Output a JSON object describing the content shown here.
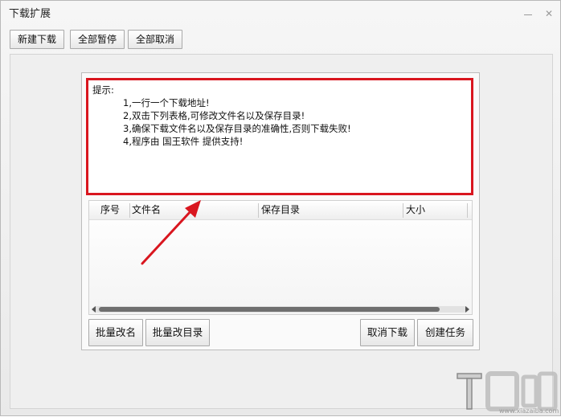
{
  "window": {
    "title": "下载扩展"
  },
  "toolbar": {
    "new_download": "新建下载",
    "pause_all": "全部暂停",
    "cancel_all": "全部取消"
  },
  "hint": {
    "label": "提示:",
    "lines": [
      "1,一行一个下载地址!",
      "2,双击下列表格,可修改文件名以及保存目录!",
      "3,确保下载文件名以及保存目录的准确性,否则下载失败!",
      "4,程序由 国王软件 提供支持!"
    ]
  },
  "table": {
    "columns": [
      "序号",
      "文件名",
      "保存目录",
      "大小"
    ]
  },
  "bottom_buttons": {
    "batch_rename": "批量改名",
    "batch_change_dir": "批量改目录",
    "cancel_download": "取消下载",
    "create_task": "创建任务"
  },
  "colors": {
    "highlight_border": "#d9161f",
    "annotation_arrow": "#d9161f"
  },
  "watermark": {
    "logo_text": "下载吧",
    "url": "www.xiazaiba.com"
  }
}
